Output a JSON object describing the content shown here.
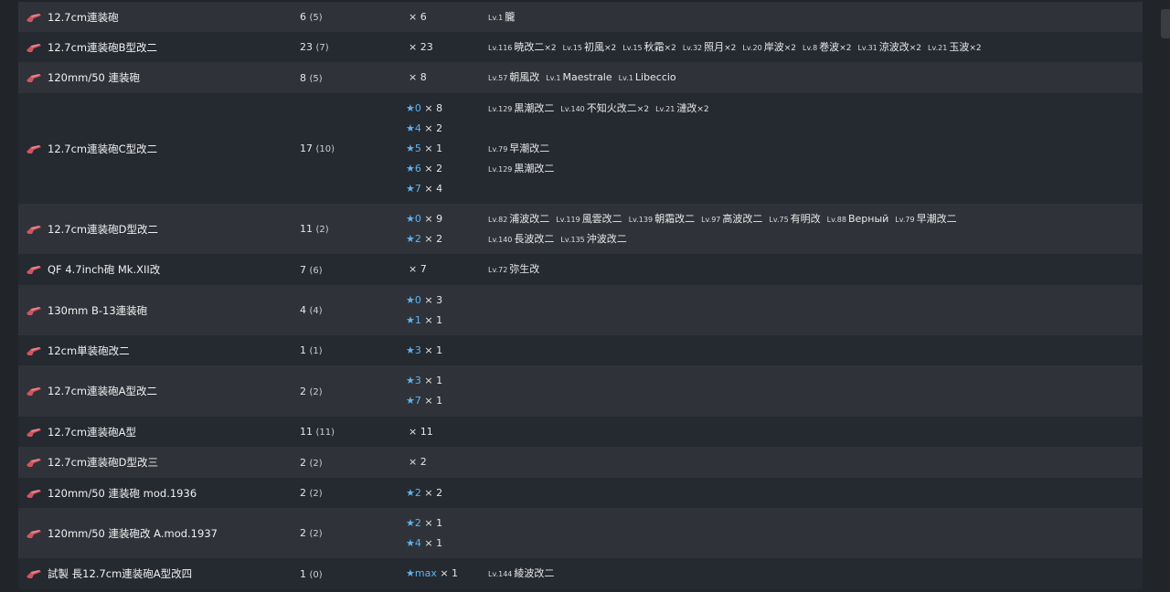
{
  "rows": [
    {
      "name": "12.7cm連装砲",
      "count": "6",
      "count_sub": "(5)",
      "stars": [
        {
          "star": "",
          "mult": "× 6"
        }
      ],
      "ship_lines": [
        [
          {
            "lv": "Lv.1",
            "name": "朧",
            "mult": ""
          }
        ]
      ],
      "height": 33
    },
    {
      "name": "12.7cm連装砲B型改二",
      "count": "23",
      "count_sub": "(7)",
      "stars": [
        {
          "star": "",
          "mult": "× 23"
        }
      ],
      "ship_lines": [
        [
          {
            "lv": "Lv.116",
            "name": "暁改二",
            "mult": "×2"
          },
          {
            "lv": "Lv.15",
            "name": "初風",
            "mult": "×2"
          },
          {
            "lv": "Lv.15",
            "name": "秋霜",
            "mult": "×2"
          },
          {
            "lv": "Lv.32",
            "name": "照月",
            "mult": "×2"
          },
          {
            "lv": "Lv.20",
            "name": "岸波",
            "mult": "×2"
          },
          {
            "lv": "Lv.8",
            "name": "巻波",
            "mult": "×2"
          },
          {
            "lv": "Lv.31",
            "name": "涼波改",
            "mult": "×2"
          },
          {
            "lv": "Lv.21",
            "name": "玉波",
            "mult": "×2"
          }
        ]
      ],
      "height": 33
    },
    {
      "name": "120mm/50 連装砲",
      "count": "8",
      "count_sub": "(5)",
      "stars": [
        {
          "star": "",
          "mult": "× 8"
        }
      ],
      "ship_lines": [
        [
          {
            "lv": "Lv.57",
            "name": "朝風改",
            "mult": ""
          },
          {
            "lv": "Lv.1",
            "name": "Maestrale",
            "mult": ""
          },
          {
            "lv": "Lv.1",
            "name": "Libeccio",
            "mult": ""
          }
        ]
      ],
      "height": 34
    },
    {
      "name": "12.7cm連装砲C型改二",
      "count": "17",
      "count_sub": "(10)",
      "stars": [
        {
          "star": "★0",
          "mult": "× 8"
        },
        {
          "star": "★4",
          "mult": "× 2"
        },
        {
          "star": "★5",
          "mult": "× 1"
        },
        {
          "star": "★6",
          "mult": "× 2"
        },
        {
          "star": "★7",
          "mult": "× 4"
        }
      ],
      "ship_lines": [
        [
          {
            "lv": "Lv.129",
            "name": "黒潮改二",
            "mult": ""
          },
          {
            "lv": "Lv.140",
            "name": "不知火改二",
            "mult": "×2"
          },
          {
            "lv": "Lv.21",
            "name": "漣改",
            "mult": "×2"
          }
        ],
        [],
        [
          {
            "lv": "Lv.79",
            "name": "早潮改二",
            "mult": ""
          }
        ],
        [
          {
            "lv": "Lv.129",
            "name": "黒潮改二",
            "mult": ""
          }
        ],
        []
      ],
      "height": 121
    },
    {
      "name": "12.7cm連装砲D型改二",
      "count": "11",
      "count_sub": "(2)",
      "stars": [
        {
          "star": "★0",
          "mult": "× 9"
        },
        {
          "star": "★2",
          "mult": "× 2"
        }
      ],
      "ship_lines": [
        [
          {
            "lv": "Lv.82",
            "name": "浦波改二",
            "mult": ""
          },
          {
            "lv": "Lv.119",
            "name": "風雲改二",
            "mult": ""
          },
          {
            "lv": "Lv.139",
            "name": "朝霜改二",
            "mult": ""
          },
          {
            "lv": "Lv.97",
            "name": "高波改二",
            "mult": ""
          },
          {
            "lv": "Lv.75",
            "name": "有明改",
            "mult": ""
          },
          {
            "lv": "Lv.88",
            "name": "Верный",
            "mult": ""
          },
          {
            "lv": "Lv.79",
            "name": "早潮改二",
            "mult": ""
          }
        ],
        [
          {
            "lv": "Lv.140",
            "name": "長波改二",
            "mult": ""
          },
          {
            "lv": "Lv.135",
            "name": "沖波改二",
            "mult": ""
          }
        ]
      ],
      "height": 55
    },
    {
      "name": "QF 4.7inch砲 Mk.XII改",
      "count": "7",
      "count_sub": "(6)",
      "stars": [
        {
          "star": "",
          "mult": "× 7"
        }
      ],
      "ship_lines": [
        [
          {
            "lv": "Lv.72",
            "name": "弥生改",
            "mult": ""
          }
        ]
      ],
      "height": 34
    },
    {
      "name": "130mm B-13連装砲",
      "count": "4",
      "count_sub": "(4)",
      "stars": [
        {
          "star": "★0",
          "mult": "× 3"
        },
        {
          "star": "★1",
          "mult": "× 1"
        }
      ],
      "ship_lines": [],
      "height": 55
    },
    {
      "name": "12cm単装砲改二",
      "count": "1",
      "count_sub": "(1)",
      "stars": [
        {
          "star": "★3",
          "mult": "× 1"
        }
      ],
      "ship_lines": [],
      "height": 33
    },
    {
      "name": "12.7cm連装砲A型改二",
      "count": "2",
      "count_sub": "(2)",
      "stars": [
        {
          "star": "★3",
          "mult": "× 1"
        },
        {
          "star": "★7",
          "mult": "× 1"
        }
      ],
      "ship_lines": [],
      "height": 56
    },
    {
      "name": "12.7cm連装砲A型",
      "count": "11",
      "count_sub": "(11)",
      "stars": [
        {
          "star": "",
          "mult": "× 11"
        }
      ],
      "ship_lines": [],
      "height": 33
    },
    {
      "name": "12.7cm連装砲D型改三",
      "count": "2",
      "count_sub": "(2)",
      "stars": [
        {
          "star": "",
          "mult": "× 2"
        }
      ],
      "ship_lines": [],
      "height": 34
    },
    {
      "name": "120mm/50 連装砲 mod.1936",
      "count": "2",
      "count_sub": "(2)",
      "stars": [
        {
          "star": "★2",
          "mult": "× 2"
        }
      ],
      "ship_lines": [],
      "height": 33
    },
    {
      "name": "120mm/50 連装砲改 A.mod.1937",
      "count": "2",
      "count_sub": "(2)",
      "stars": [
        {
          "star": "★2",
          "mult": "× 1"
        },
        {
          "star": "★4",
          "mult": "× 1"
        }
      ],
      "ship_lines": [],
      "height": 55
    },
    {
      "name": "試製 長12.7cm連装砲A型改四",
      "count": "1",
      "count_sub": "(0)",
      "stars": [
        {
          "star": "★max",
          "mult": "× 1"
        }
      ],
      "ship_lines": [
        [
          {
            "lv": "Lv.144",
            "name": "綾波改二",
            "mult": ""
          }
        ]
      ],
      "height": 34
    }
  ]
}
